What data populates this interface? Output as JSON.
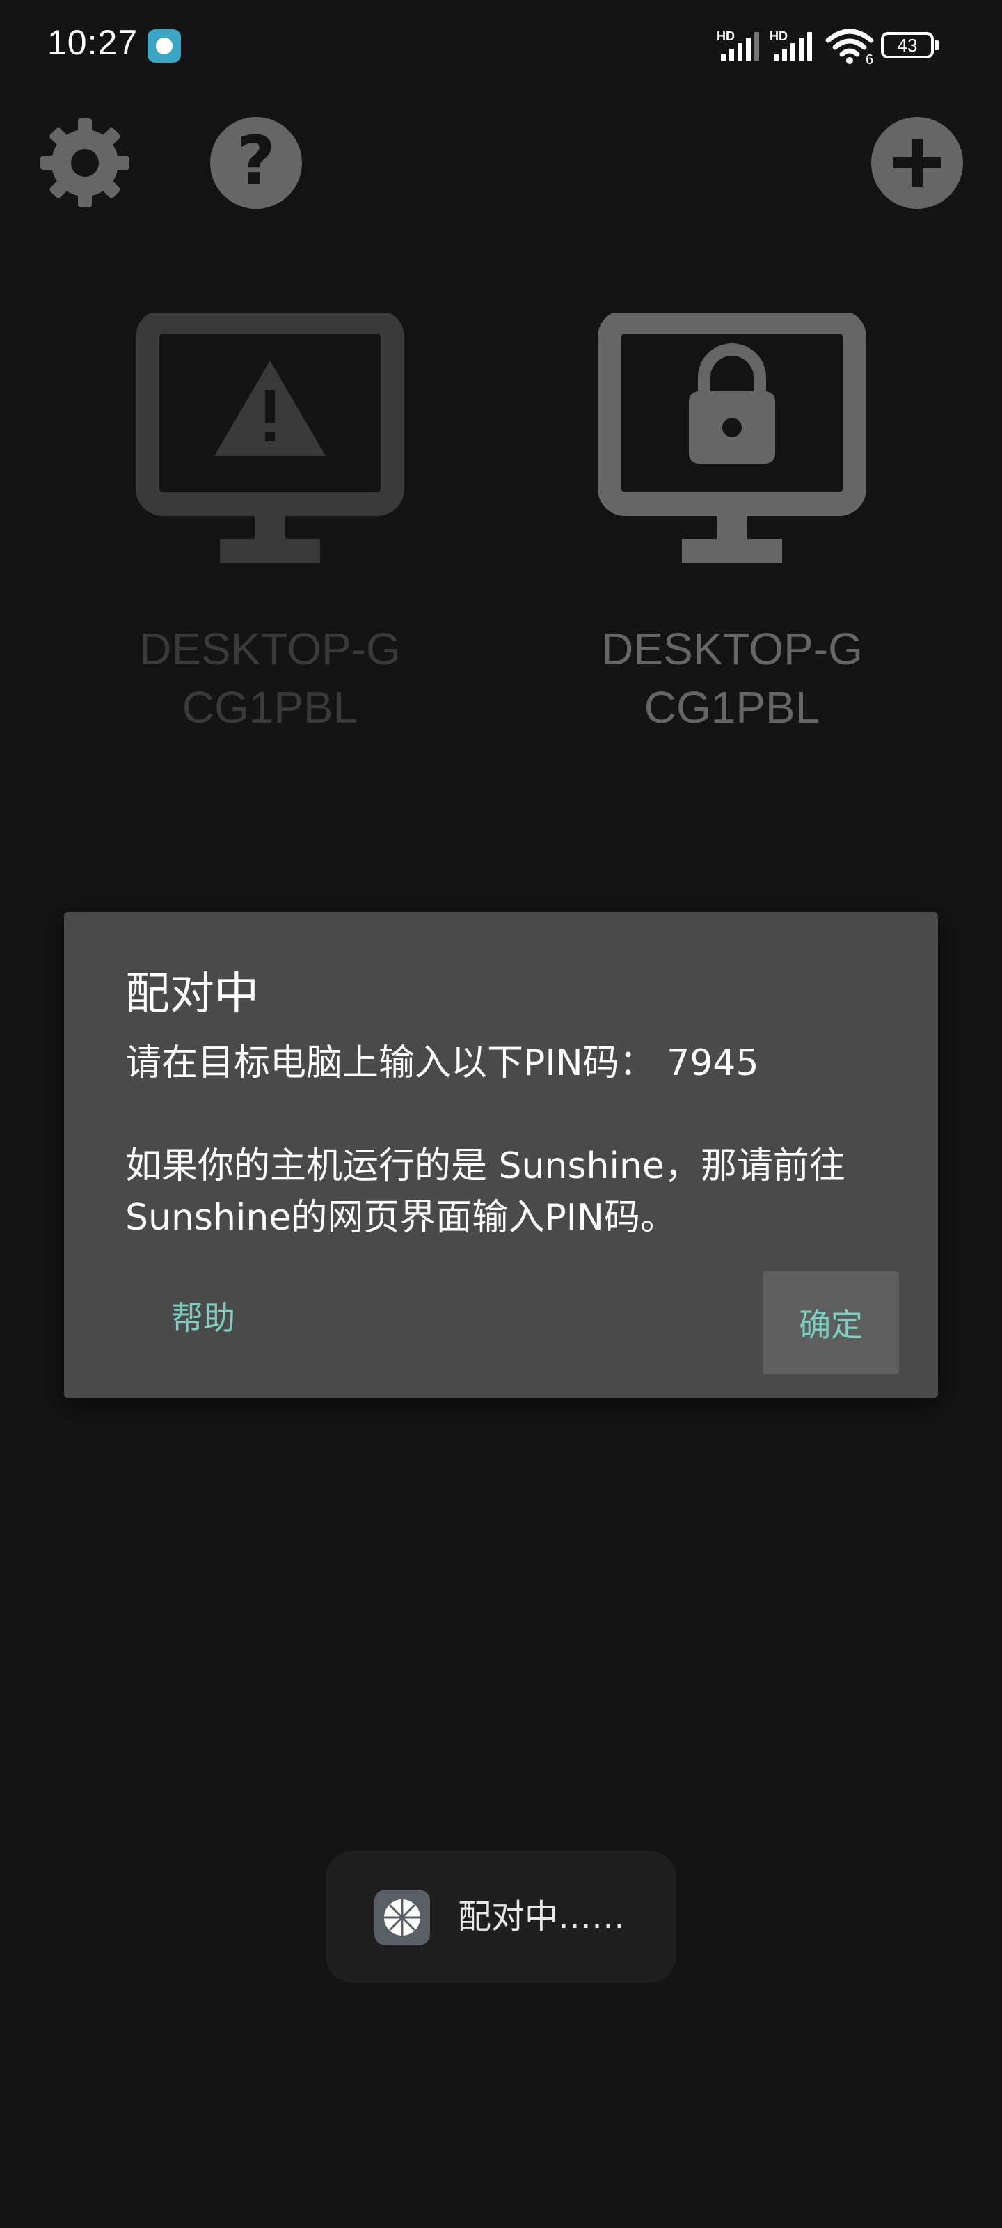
{
  "status_bar": {
    "time": "10:27",
    "signal1_label": "HD",
    "signal2_label": "HD",
    "wifi_badge": "6",
    "battery": "43",
    "icons": [
      "notification-app-icon",
      "signal-icon",
      "signal-icon",
      "wifi-icon",
      "battery-icon"
    ]
  },
  "toolbar": {
    "icons": [
      "gear-icon",
      "question-mark-icon",
      "plus-icon"
    ]
  },
  "computers": [
    {
      "name": "DESKTOP-GCG1PBL",
      "state_icon": "warning-icon"
    },
    {
      "name": "DESKTOP-GCG1PBL",
      "state_icon": "lock-icon"
    }
  ],
  "dialog": {
    "title": "配对中",
    "message": "请在目标电脑上输入以下PIN码： 7945\n\n如果你的主机运行的是 Sunshine，那请前往Sunshine的网页界面输入PIN码。",
    "help_label": "帮助",
    "ok_label": "确定"
  },
  "toast": {
    "text": "配对中……",
    "icon": "app-icon"
  },
  "colors": {
    "background": "#141414",
    "dialog_bg": "#4a4a4a",
    "accent": "#7fcfc0",
    "icon_gray": "#666666"
  }
}
